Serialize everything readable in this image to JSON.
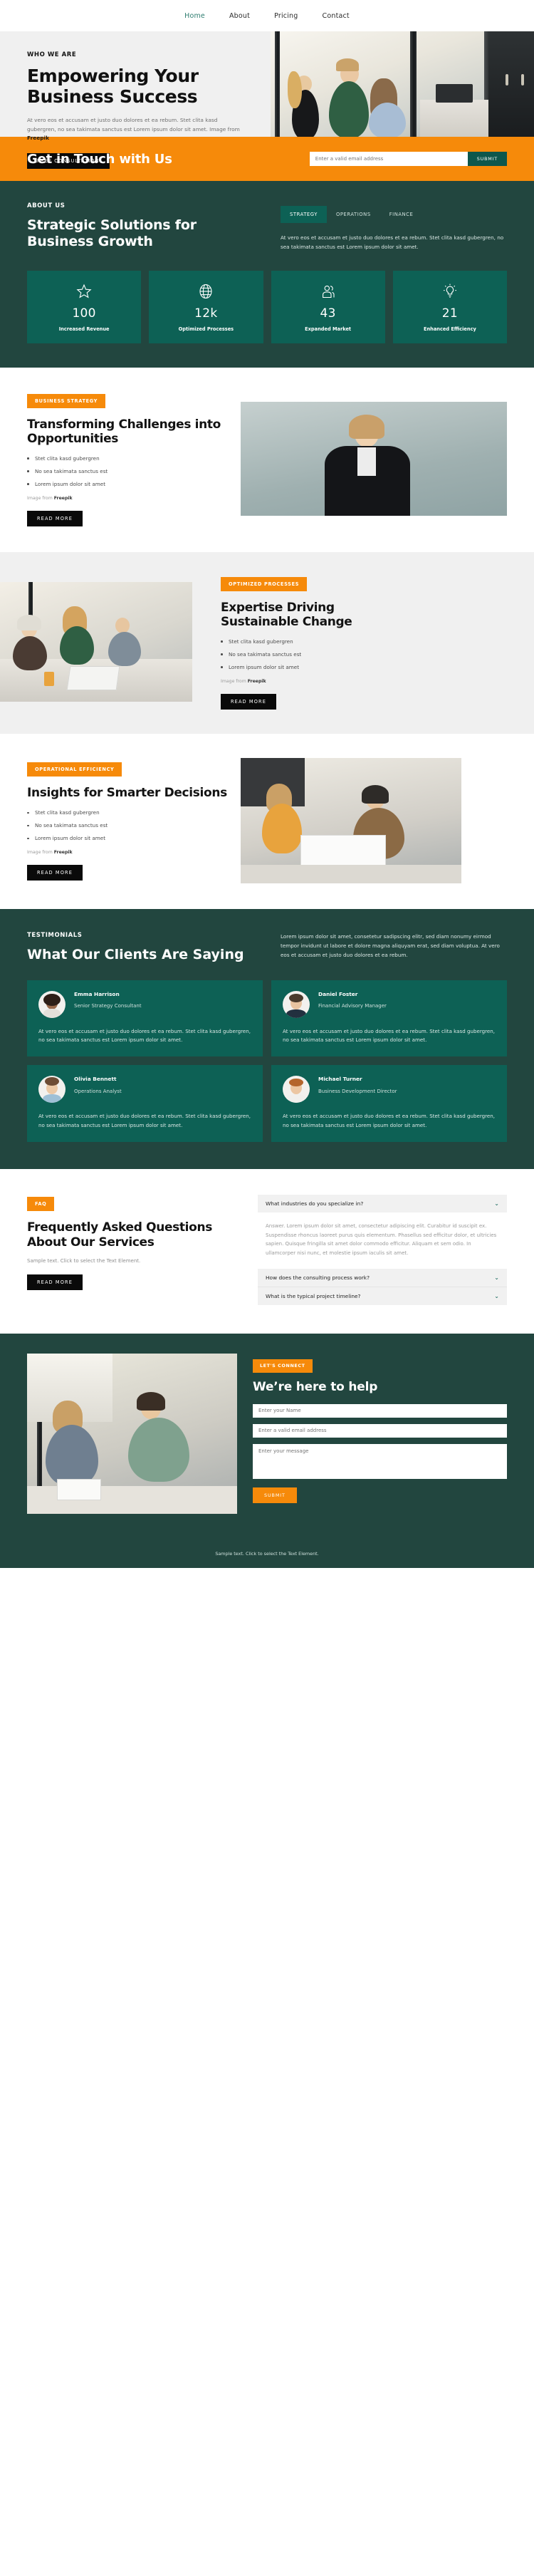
{
  "colors": {
    "orange": "#f68a0a",
    "dark_green": "#22463f",
    "teal": "#0d6155",
    "light_gray": "#f0f0f0",
    "black": "#0a0a0a"
  },
  "nav": {
    "items": [
      {
        "label": "Home",
        "active": true
      },
      {
        "label": "About",
        "active": false
      },
      {
        "label": "Pricing",
        "active": false
      },
      {
        "label": "Contact",
        "active": false
      }
    ]
  },
  "hero": {
    "eyebrow": "WHO WE ARE",
    "title": "Empowering Your Business Success",
    "paragraph": "At vero eos et accusam et justo duo dolores et ea rebum. Stet clita kasd gubergren, no sea takimata sanctus est Lorem ipsum dolor sit amet. Image from ",
    "paragraph_bold": "Freepik",
    "button": "FREE CONSULTATION"
  },
  "cta": {
    "title": "Get in Touch with Us",
    "email_placeholder": "Enter a valid email address",
    "email_value": "",
    "submit": "SUBMIT"
  },
  "about": {
    "eyebrow": "ABOUT US",
    "title": "Strategic Solutions for Business Growth",
    "tabs": [
      {
        "label": "STRATEGY",
        "active": true
      },
      {
        "label": "OPERATIONS",
        "active": false
      },
      {
        "label": "FINANCE",
        "active": false
      }
    ],
    "paragraph": "At vero eos et accusam et justo duo dolores et ea rebum. Stet clita kasd gubergren, no sea takimata sanctus est Lorem ipsum dolor sit amet.",
    "stats": [
      {
        "icon": "star-icon",
        "value": "100",
        "label": "Increased Revenue"
      },
      {
        "icon": "globe-icon",
        "value": "12k",
        "label": "Optimized Processes"
      },
      {
        "icon": "users-icon",
        "value": "43",
        "label": "Expanded Market"
      },
      {
        "icon": "bulb-icon",
        "value": "21",
        "label": "Enhanced Efficiency"
      }
    ]
  },
  "features": [
    {
      "badge": "BUSINESS STRATEGY",
      "title": "Transforming Challenges into Opportunities",
      "bullets": [
        "Stet clita kasd gubergren",
        "No sea takimata sanctus est",
        "Lorem ipsum dolor sit amet"
      ],
      "credit": "Image from ",
      "credit_bold": "Freepik",
      "button": "READ MORE"
    },
    {
      "badge": "OPTIMIZED PROCESSES",
      "title": "Expertise Driving Sustainable Change",
      "bullets": [
        "Stet clita kasd gubergren",
        "No sea takimata sanctus est",
        "Lorem ipsum dolor sit amet"
      ],
      "credit": "Image from ",
      "credit_bold": "Freepik",
      "button": "READ MORE"
    },
    {
      "badge": "OPERATIONAL EFFICIENCY",
      "title": "Insights for Smarter Decisions",
      "bullets": [
        "Stet clita kasd gubergren",
        "No sea takimata sanctus est",
        "Lorem ipsum dolor sit amet"
      ],
      "credit": "Image from ",
      "credit_bold": "Freepik",
      "button": "READ MORE"
    }
  ],
  "testimonials": {
    "eyebrow": "TESTIMONIALS",
    "title": "What Our Clients Are Saying",
    "intro": "Lorem ipsum dolor sit amet, consetetur sadipscing elitr, sed diam nonumy eirmod tempor invidunt ut labore et dolore magna aliquyam erat, sed diam voluptua. At vero eos et accusam et justo duo dolores et ea rebum.",
    "cards": [
      {
        "name": "Emma Harrison",
        "role": "Senior Strategy Consultant",
        "quote": "At vero eos et accusam et justo duo dolores et ea rebum. Stet clita kasd gubergren, no sea takimata sanctus est Lorem ipsum dolor sit amet."
      },
      {
        "name": "Daniel Foster",
        "role": "Financial Advisory Manager",
        "quote": "At vero eos et accusam et justo duo dolores et ea rebum. Stet clita kasd gubergren, no sea takimata sanctus est Lorem ipsum dolor sit amet."
      },
      {
        "name": "Olivia Bennett",
        "role": "Operations Analyst",
        "quote": "At vero eos et accusam et justo duo dolores et ea rebum. Stet clita kasd gubergren, no sea takimata sanctus est Lorem ipsum dolor sit amet."
      },
      {
        "name": "Michael Turner",
        "role": "Business Development Director",
        "quote": "At vero eos et accusam et justo duo dolores et ea rebum. Stet clita kasd gubergren, no sea takimata sanctus est Lorem ipsum dolor sit amet."
      }
    ]
  },
  "faq": {
    "badge": "FAQ",
    "title": "Frequently Asked Questions About Our Services",
    "sample_text": "Sample text. Click to select the Text Element.",
    "button": "READ MORE",
    "items": [
      {
        "question": "What industries do you specialize in?",
        "answer": "Answer. Lorem ipsum dolor sit amet, consectetur adipiscing elit. Curabitur id suscipit ex. Suspendisse rhoncus laoreet purus quis elementum. Phasellus sed efficitur dolor, et ultricies sapien. Quisque fringilla sit amet dolor commodo efficitur. Aliquam et sem odio. In ullamcorper nisi nunc, et molestie ipsum iaculis sit amet.",
        "open": true
      },
      {
        "question": "How does the consulting process work?",
        "answer": "",
        "open": false
      },
      {
        "question": "What is the typical project timeline?",
        "answer": "",
        "open": false
      }
    ]
  },
  "contact": {
    "badge": "LET'S CONNECT",
    "title": "We’re here to help",
    "name_placeholder": "Enter your Name",
    "name_value": "",
    "email_placeholder": "Enter a valid email address",
    "email_value": "",
    "message_placeholder": "Enter your message",
    "message_value": "",
    "submit": "SUBMIT"
  },
  "footer": {
    "note": "Sample text. Click to select the Text Element."
  }
}
